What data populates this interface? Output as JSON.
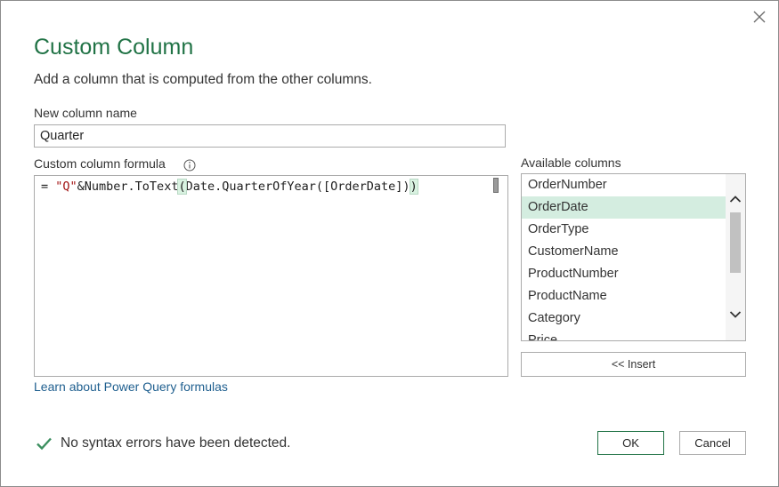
{
  "dialog": {
    "title": "Custom Column",
    "subtitle": "Add a column that is computed from the other columns."
  },
  "new_column": {
    "label": "New column name",
    "value": "Quarter"
  },
  "formula": {
    "label": "Custom column formula",
    "prefix": "= ",
    "string_token": "\"Q\"",
    "middle": "&Number.ToText",
    "open_paren": "(",
    "inner": "Date.QuarterOfYear([OrderDate])",
    "close_paren": ")"
  },
  "learn_link": "Learn about Power Query formulas",
  "available_columns": {
    "label": "Available columns",
    "items": [
      "OrderNumber",
      "OrderDate",
      "OrderType",
      "CustomerName",
      "ProductNumber",
      "ProductName",
      "Category",
      "Price"
    ],
    "selected": "OrderDate"
  },
  "insert_label": "<< Insert",
  "status": {
    "text": "No syntax errors have been detected.",
    "icon": "checkmark-icon"
  },
  "buttons": {
    "ok": "OK",
    "cancel": "Cancel"
  },
  "colors": {
    "accent": "#217346",
    "selected_row": "#d4ede0",
    "link": "#1f5f8f",
    "string": "#a31515"
  }
}
